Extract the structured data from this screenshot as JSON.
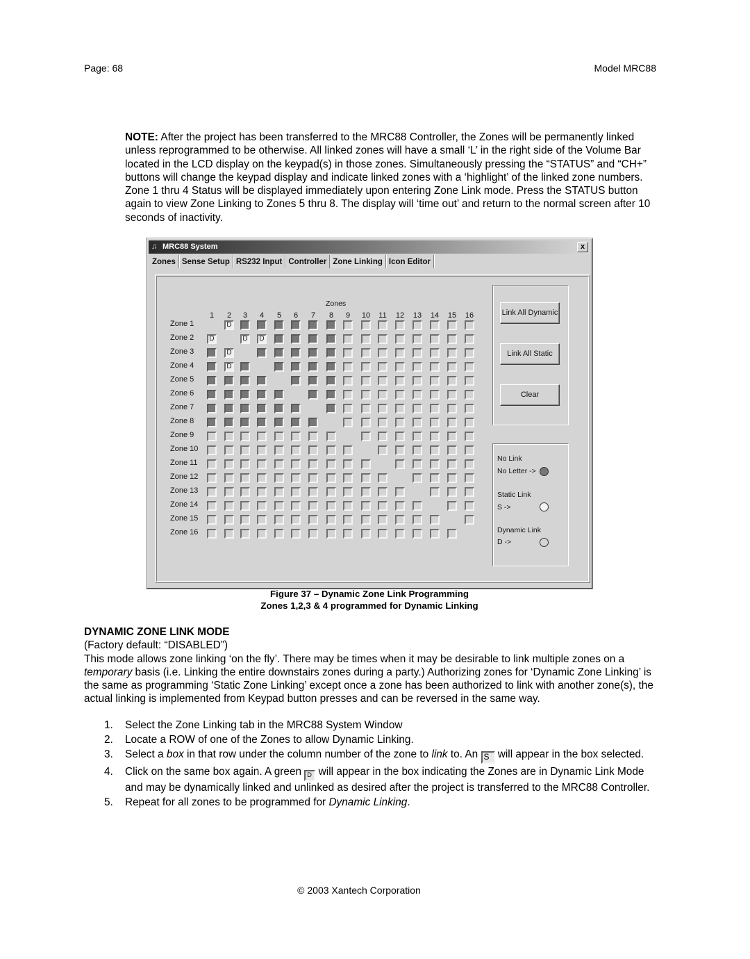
{
  "header": {
    "page": "Page: 68",
    "model": "Model MRC88"
  },
  "note": {
    "lead": "NOTE:",
    "text": " After the project has been transferred to the MRC88 Controller, the Zones will be permanently linked unless reprogrammed to be otherwise. All linked zones will have a small ‘L’ in the right side of the Volume Bar located in the LCD display on the keypad(s) in those zones. Simultaneously pressing the “STATUS” and “CH+” buttons will change the keypad display and indicate linked zones with a ‘highlight’ of the linked zone numbers. Zone 1 thru 4 Status will be displayed immediately upon entering Zone Link mode. Press the STATUS button again to view Zone Linking to Zones 5 thru 8. The display will ‘time out’ and return to the normal screen after 10 seconds of inactivity."
  },
  "window": {
    "title": "MRC88 System",
    "close_label": "x",
    "tabs": [
      {
        "label": "Zones",
        "active": false
      },
      {
        "label": "Sense Setup",
        "active": false
      },
      {
        "label": "RS232 Input",
        "active": false
      },
      {
        "label": "Controller",
        "active": false
      },
      {
        "label": "Zone Linking",
        "active": true
      },
      {
        "label": "Icon Editor",
        "active": false
      }
    ],
    "grid": {
      "title": "Zones",
      "columns": [
        "1",
        "2",
        "3",
        "4",
        "5",
        "6",
        "7",
        "8",
        "9",
        "10",
        "11",
        "12",
        "13",
        "14",
        "15",
        "16"
      ],
      "rows": [
        "Zone 1",
        "Zone 2",
        "Zone 3",
        "Zone 4",
        "Zone 5",
        "Zone 6",
        "Zone 7",
        "Zone 8",
        "Zone 9",
        "Zone 10",
        "Zone 11",
        "Zone 12",
        "Zone 13",
        "Zone 14",
        "Zone 15",
        "Zone 16"
      ],
      "legend_codes": {
        "x": "self (no box)",
        "n": "no link (filled)",
        "e": "empty box",
        "D": "dynamic link"
      },
      "cells": [
        "xDnnnnnneeeeeeee",
        "DxDDnnnneeeeeeee",
        "nDxnnnnneeeeeeee",
        "nDnxnnnneeeeeeee",
        "nnnnxnnneeeeeeee",
        "nnnnnxnneeeeeeee",
        "nnnnnnxneeeeeeee",
        "nnnnnnnxeeeeeeee",
        "eeeeeeeexeeeeeee",
        "eeeeeeeeexeeeeee",
        "eeeeeeeeeexeeeee",
        "eeeeeeeeeeexeeee",
        "eeeeeeeeeeeexeee",
        "eeeeeeeeeeeeexee",
        "eeeeeeeeeeeeeexe",
        "eeeeeeeeeeeeeeex"
      ],
      "dynamic_letter": "D"
    },
    "buttons": {
      "link_all_dynamic": "Link All Dynamic",
      "link_all_static": "Link All Static",
      "clear": "Clear"
    },
    "legend": {
      "no_link_title": "No Link",
      "no_link_sub": "No Letter ->",
      "static_title": "Static Link",
      "static_sub": "S ->",
      "dynamic_title": "Dynamic Link",
      "dynamic_sub": "D ->"
    }
  },
  "caption": {
    "line1": "Figure 37 – Dynamic Zone Link Programming",
    "line2": "Zones 1,2,3 & 4 programmed for Dynamic Linking"
  },
  "section": {
    "heading": "DYNAMIC ZONE LINK MODE",
    "default": "(Factory default: “DISABLED”)",
    "body_a": "This mode allows zone linking ‘on the fly’. There may be times when it may be desirable to link multiple zones on a ",
    "body_em": "temporary",
    "body_b": " basis (i.e. Linking the entire downstairs zones during a party.) Authorizing zones for ‘Dynamic Zone Linking’ is the same as programming ‘Static Zone Linking’ except once a zone has been authorized to link with another zone(s), the actual linking is implemented from Keypad button presses and can be reversed in the same way."
  },
  "steps": [
    {
      "num": "1.",
      "text": "Select the Zone Linking tab in the MRC88 System Window"
    },
    {
      "num": "2.",
      "text": "Locate a ROW of one of the Zones to allow Dynamic Linking."
    },
    {
      "num": "3.",
      "a": "Select a ",
      "em1": "box",
      "b": " in that row under the column number of the zone to ",
      "em2": "link",
      "c": " to. An ",
      "icon": "S",
      "d": " will appear in the box selected."
    },
    {
      "num": "4.",
      "a": "Click on the same box again. A green ",
      "icon": "D",
      "b": " will appear in the box indicating the Zones are in Dynamic Link Mode and may be dynamically linked and unlinked as desired after the project is transferred to the MRC88 Controller."
    },
    {
      "num": "5.",
      "a": "Repeat for all zones to be programmed for ",
      "em": "Dynamic Linking",
      "b": "."
    }
  ],
  "footer": "© 2003 Xantech Corporation"
}
